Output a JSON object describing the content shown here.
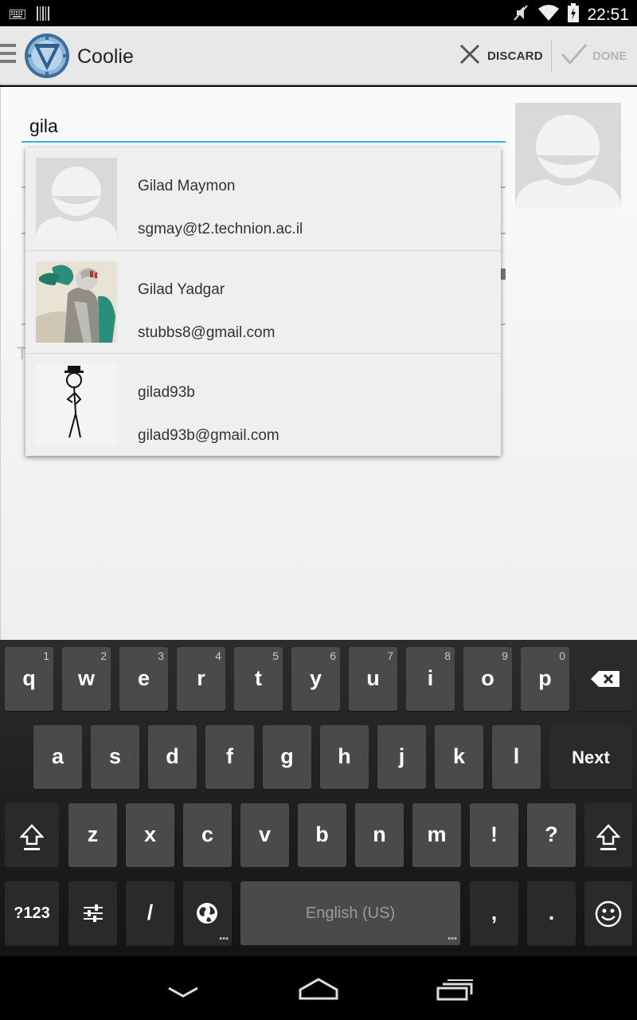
{
  "status_bar": {
    "time": "22:51"
  },
  "action_bar": {
    "app_title": "Coolie",
    "discard_label": "DISCARD",
    "done_label": "DONE"
  },
  "form": {
    "name_value": "gila",
    "hint_char": "T"
  },
  "suggestions": [
    {
      "name": "Gilad Maymon",
      "email": "sgmay@t2.technion.ac.il",
      "photo": "default-avatar"
    },
    {
      "name": "Gilad Yadgar",
      "email": "stubbs8@gmail.com",
      "photo": "illustrated-portrait"
    },
    {
      "name": "gilad93b",
      "email": "gilad93b@gmail.com",
      "photo": "stick-figure-with-hat"
    }
  ],
  "keyboard": {
    "row1": [
      {
        "key": "q",
        "hint": "1"
      },
      {
        "key": "w",
        "hint": "2"
      },
      {
        "key": "e",
        "hint": "3"
      },
      {
        "key": "r",
        "hint": "4"
      },
      {
        "key": "t",
        "hint": "5"
      },
      {
        "key": "y",
        "hint": "6"
      },
      {
        "key": "u",
        "hint": "7"
      },
      {
        "key": "i",
        "hint": "8"
      },
      {
        "key": "o",
        "hint": "9"
      },
      {
        "key": "p",
        "hint": "0"
      }
    ],
    "row2": [
      "a",
      "s",
      "d",
      "f",
      "g",
      "h",
      "j",
      "k",
      "l"
    ],
    "next_label": "Next",
    "row3": [
      "z",
      "x",
      "c",
      "v",
      "b",
      "n",
      "m",
      "!",
      "?"
    ],
    "symbols_label": "?123",
    "slash_label": "/",
    "space_label": "English (US)",
    "comma_label": ",",
    "period_label": "."
  },
  "colors": {
    "accent": "#33b5e5",
    "action_bar_bg": "#e8e8e8",
    "key_bg": "#4a4a4a",
    "key_dark_bg": "#2a2a2a"
  }
}
